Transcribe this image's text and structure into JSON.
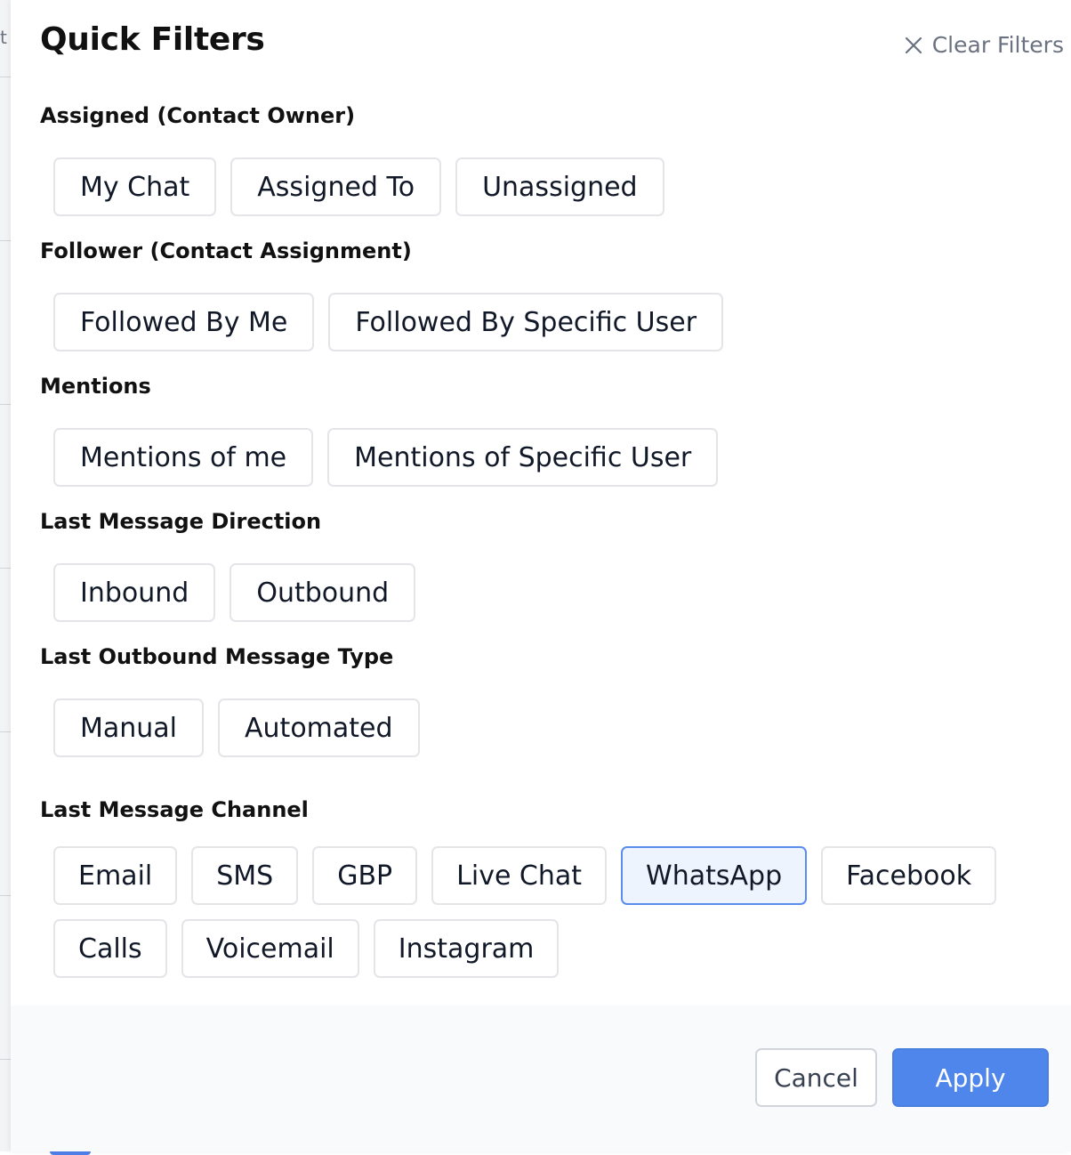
{
  "backdrop": {
    "partial_text": "t"
  },
  "panel": {
    "title": "Quick Filters",
    "clear_filters_label": "Clear Filters"
  },
  "sections": {
    "assigned": {
      "label": "Assigned (Contact Owner)",
      "options": [
        "My Chat",
        "Assigned To",
        "Unassigned"
      ]
    },
    "follower": {
      "label": "Follower (Contact Assignment)",
      "options": [
        "Followed By Me",
        "Followed By Specific User"
      ]
    },
    "mentions": {
      "label": "Mentions",
      "options": [
        "Mentions of me",
        "Mentions of Specific User"
      ]
    },
    "direction": {
      "label": "Last Message Direction",
      "options": [
        "Inbound",
        "Outbound"
      ]
    },
    "outbound_type": {
      "label": "Last Outbound Message Type",
      "options": [
        "Manual",
        "Automated"
      ]
    },
    "channel": {
      "label": "Last Message Channel",
      "options": [
        "Email",
        "SMS",
        "GBP",
        "Live Chat",
        "WhatsApp",
        "Facebook",
        "Calls",
        "Voicemail",
        "Instagram"
      ],
      "selected": "WhatsApp"
    }
  },
  "footer": {
    "cancel_label": "Cancel",
    "apply_label": "Apply"
  },
  "colors": {
    "accent": "#4f86ec",
    "selected_border": "#5b8def",
    "selected_bg": "#eef4fe",
    "muted_text": "#6b7280"
  }
}
